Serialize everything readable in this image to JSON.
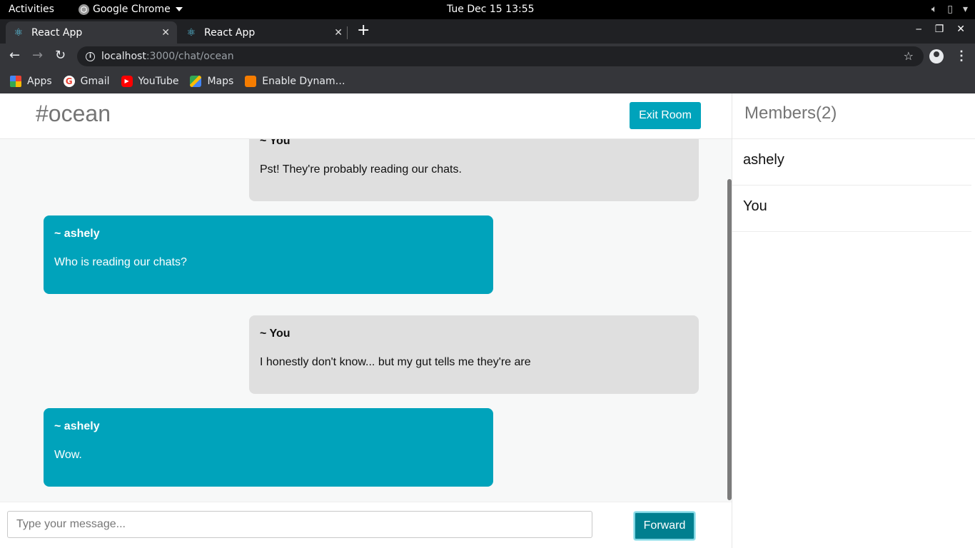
{
  "system": {
    "activities": "Activities",
    "app_name": "Google Chrome",
    "clock": "Tue Dec 15  13:55"
  },
  "browser": {
    "tabs": [
      {
        "label": "React App",
        "active": true
      },
      {
        "label": "React App",
        "active": false
      }
    ],
    "url_host": "localhost",
    "url_rest": ":3000/chat/ocean",
    "bookmarks": [
      {
        "label": "Apps",
        "icon": "apps-grid-icon"
      },
      {
        "label": "Gmail",
        "icon": "gmail-icon"
      },
      {
        "label": "YouTube",
        "icon": "youtube-icon"
      },
      {
        "label": "Maps",
        "icon": "maps-icon"
      },
      {
        "label": "Enable Dynam…",
        "icon": "bookmark-flag-icon"
      }
    ]
  },
  "chat": {
    "room_name": "#ocean",
    "exit_label": "Exit Room",
    "messages": [
      {
        "author": "~ You",
        "text": "Pst! They're probably reading our chats.",
        "mine": true
      },
      {
        "author": "~ ashely",
        "text": "Who is reading our chats?",
        "mine": false
      },
      {
        "author": "~ You",
        "text": "I honestly don't know... but my gut tells me they're are",
        "mine": true
      },
      {
        "author": "~ ashely",
        "text": "Wow.",
        "mine": false
      }
    ],
    "input_placeholder": "Type your message...",
    "send_label": "Forward"
  },
  "members": {
    "title": "Members(2)",
    "list": [
      {
        "name": "ashely"
      },
      {
        "name": "You"
      }
    ]
  },
  "colors": {
    "accent": "#00a3bb",
    "own_bubble": "#dfdfdf",
    "forward_button": "#007f8f"
  }
}
